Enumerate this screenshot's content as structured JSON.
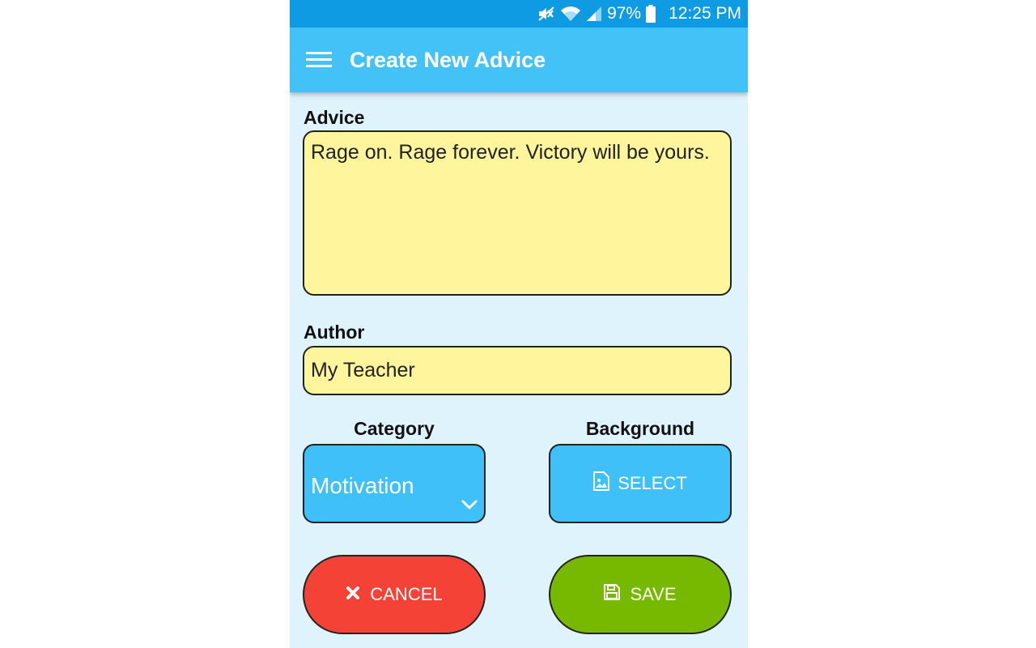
{
  "status_bar": {
    "battery": "97%",
    "time": "12:25 PM",
    "icons": [
      "mute-icon",
      "wifi-icon",
      "signal-icon",
      "battery-icon"
    ]
  },
  "app_bar": {
    "title": "Create New Advice",
    "menu_icon": "hamburger-menu-icon"
  },
  "form": {
    "advice_label": "Advice",
    "advice_value": "Rage on. Rage forever. Victory will be yours.",
    "author_label": "Author",
    "author_value": "My Teacher",
    "category_label": "Category",
    "category_value": "Motivation",
    "background_label": "Background",
    "select_label": "SELECT"
  },
  "actions": {
    "cancel_label": "CANCEL",
    "save_label": "SAVE"
  },
  "colors": {
    "status_bar": "#0f9be3",
    "app_bar": "#43c2f8",
    "page_bg": "#dff3fc",
    "input_bg": "#fff59d",
    "accent_button": "#40c0f8",
    "cancel": "#f44336",
    "save": "#76b900"
  }
}
